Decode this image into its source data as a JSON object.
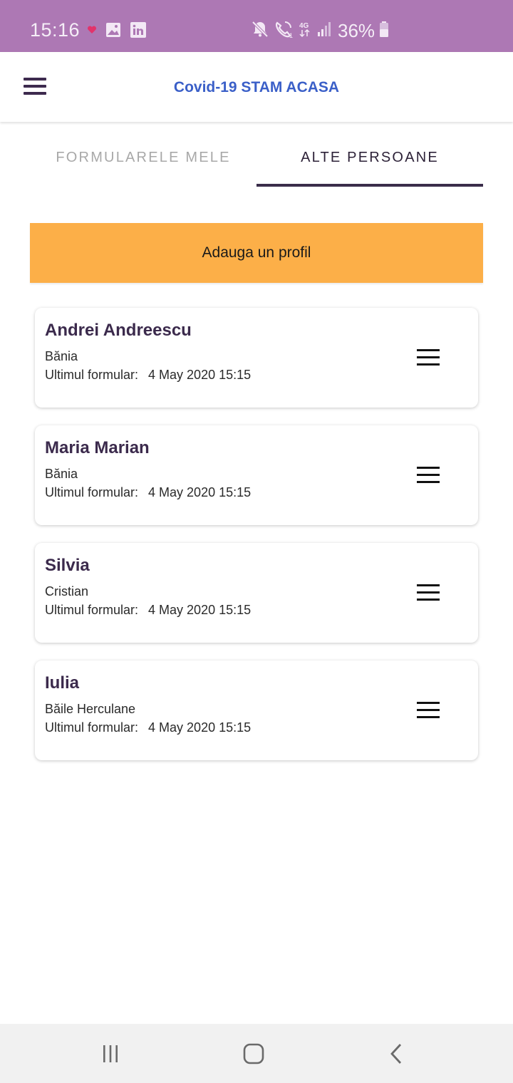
{
  "status_bar": {
    "time": "15:16",
    "battery": "36%",
    "network": "4G",
    "icons_left": [
      "heart-icon",
      "gallery-icon",
      "linkedin-icon"
    ],
    "icons_right": [
      "mute-icon",
      "wifi-call-icon",
      "network-4g-icon",
      "signal-icon",
      "battery-icon"
    ]
  },
  "app_bar": {
    "title": "Covid-19 STAM ACASA",
    "menu_icon": "hamburger-menu-icon"
  },
  "tabs": [
    {
      "label": "FORMULARELE MELE",
      "active": false
    },
    {
      "label": "ALTE PERSOANE",
      "active": true
    }
  ],
  "add_profile_label": "Adauga un profil",
  "profiles": [
    {
      "name": "Andrei Andreescu",
      "place": "Bănia",
      "last_label": "Ultimul formular:",
      "last_date": "4 May 2020 15:15"
    },
    {
      "name": "Maria Marian",
      "place": "Bănia",
      "last_label": "Ultimul formular:",
      "last_date": "4 May 2020 15:15"
    },
    {
      "name": "Silvia",
      "place": "Cristian",
      "last_label": "Ultimul formular:",
      "last_date": "4 May 2020 15:15"
    },
    {
      "name": "Iulia",
      "place": "Băile Herculane",
      "last_label": "Ultimul formular:",
      "last_date": "4 May 2020 15:15"
    }
  ],
  "nav_bar": {
    "icons": [
      "recent-apps-icon",
      "home-icon",
      "back-icon"
    ]
  },
  "colors": {
    "status_bar": "#ad78b4",
    "title": "#3a5fc8",
    "accent_button": "#fcaf48",
    "tab_indicator": "#3a2d4a",
    "name_text": "#3b2a4c"
  }
}
